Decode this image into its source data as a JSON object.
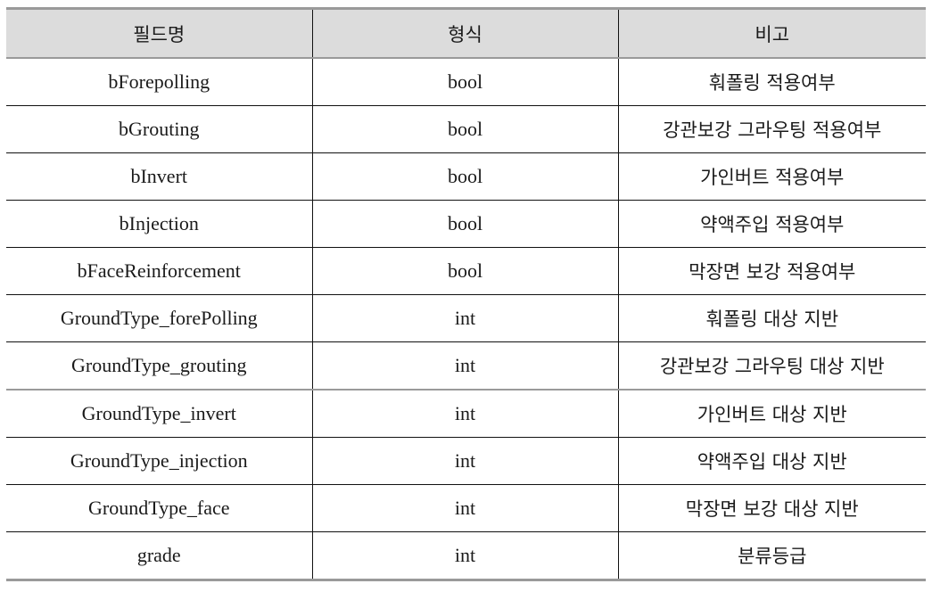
{
  "table": {
    "headers": [
      "필드명",
      "형식",
      "비고"
    ],
    "rows": [
      {
        "field": "bForepolling",
        "type": "bool",
        "note": "훠폴링 적용여부"
      },
      {
        "field": "bGrouting",
        "type": "bool",
        "note": "강관보강 그라우팅 적용여부"
      },
      {
        "field": "bInvert",
        "type": "bool",
        "note": "가인버트 적용여부"
      },
      {
        "field": "bInjection",
        "type": "bool",
        "note": "약액주입 적용여부"
      },
      {
        "field": "bFaceReinforcement",
        "type": "bool",
        "note": "막장면 보강 적용여부"
      },
      {
        "field": "GroundType_forePolling",
        "type": "int",
        "note": "훠폴링 대상 지반"
      },
      {
        "field": "GroundType_grouting",
        "type": "int",
        "note": "강관보강 그라우팅 대상 지반"
      },
      {
        "field": "GroundType_invert",
        "type": "int",
        "note": "가인버트 대상 지반"
      },
      {
        "field": "GroundType_injection",
        "type": "int",
        "note": "약액주입 대상 지반"
      },
      {
        "field": "GroundType_face",
        "type": "int",
        "note": "막장면 보강 대상 지반"
      },
      {
        "field": "grade",
        "type": "int",
        "note": "분류등급"
      }
    ]
  }
}
